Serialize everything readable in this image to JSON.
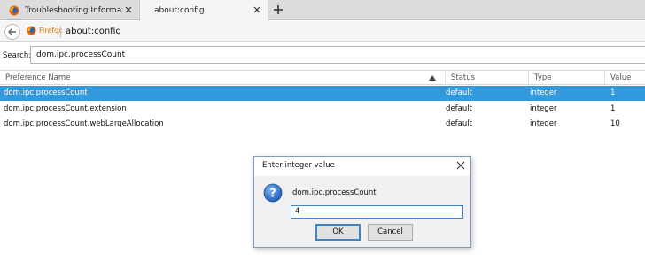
{
  "tabs": [
    {
      "title": "Troubleshooting Information",
      "active": false
    },
    {
      "title": "about:config",
      "active": true
    }
  ],
  "navbar": {
    "identity_label": "Firefox",
    "url": "about:config"
  },
  "search": {
    "label": "Search:",
    "value": "dom.ipc.processCount"
  },
  "table": {
    "columns": [
      "Preference Name",
      "Status",
      "Type",
      "Value"
    ],
    "rows": [
      {
        "name": "dom.ipc.processCount",
        "status": "default",
        "type": "integer",
        "value": "1",
        "selected": true
      },
      {
        "name": "dom.ipc.processCount.extension",
        "status": "default",
        "type": "integer",
        "value": "1",
        "selected": false
      },
      {
        "name": "dom.ipc.processCount.webLargeAllocation",
        "status": "default",
        "type": "integer",
        "value": "10",
        "selected": false
      }
    ]
  },
  "dialog": {
    "title": "Enter integer value",
    "message": "dom.ipc.processCount",
    "input_value": "4",
    "ok_label": "OK",
    "cancel_label": "Cancel",
    "icon": "question-icon"
  },
  "colors": {
    "selection": "#3399dd",
    "brand": "#d97a00",
    "focus": "#3d83c8"
  }
}
